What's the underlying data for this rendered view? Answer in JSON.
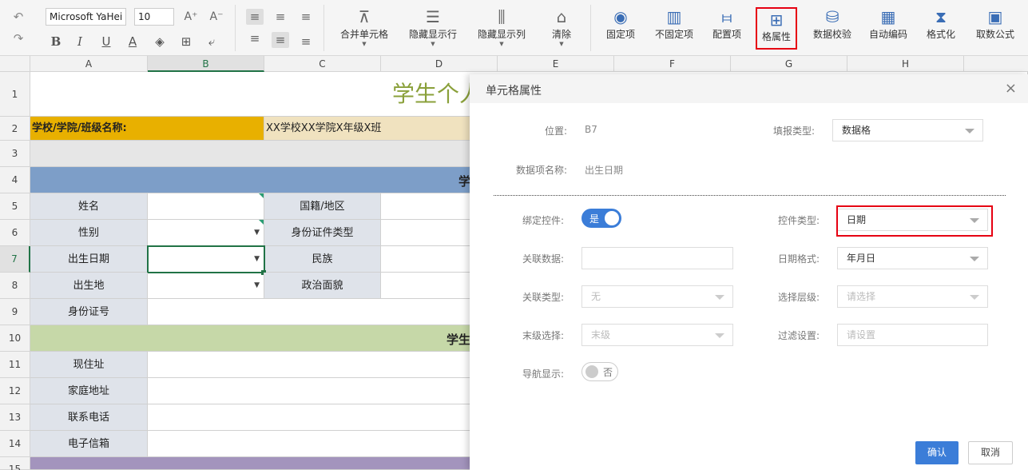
{
  "toolbar": {
    "font_name": "Microsoft YaHei",
    "font_size": "10",
    "buttons": [
      {
        "label": "合并单元格",
        "icon": "merge-cells-icon"
      },
      {
        "label": "隐藏显示行",
        "icon": "hide-rows-icon"
      },
      {
        "label": "隐藏显示列",
        "icon": "hide-columns-icon"
      },
      {
        "label": "清除",
        "icon": "eraser-icon"
      },
      {
        "label": "固定项",
        "icon": "fixed-item-icon"
      },
      {
        "label": "不固定项",
        "icon": "unfixed-item-icon"
      },
      {
        "label": "配置项",
        "icon": "config-icon"
      },
      {
        "label": "格属性",
        "icon": "cell-property-icon"
      },
      {
        "label": "数据校验",
        "icon": "data-validation-icon"
      },
      {
        "label": "自动编码",
        "icon": "barcode-icon"
      },
      {
        "label": "格式化",
        "icon": "hourglass-icon"
      },
      {
        "label": "取数公式",
        "icon": "book-icon"
      }
    ],
    "selected_button": "格属性",
    "accent_color": "#e60012"
  },
  "sheet": {
    "columns": [
      "A",
      "B",
      "C",
      "D",
      "E",
      "F",
      "G",
      "H"
    ],
    "selected_column": "B",
    "rows": [
      "1",
      "2",
      "3",
      "4",
      "5",
      "6",
      "7",
      "8",
      "9",
      "10",
      "11",
      "12",
      "13",
      "14",
      "15"
    ],
    "selected_row": "7",
    "title": "学生个人",
    "school_label": "学校/学院/班级名称:",
    "school_value": "XX学校XX学院X年级X班",
    "section1": "学",
    "section2": "学生",
    "labels": {
      "name": "姓名",
      "gender": "性别",
      "birthdate": "出生日期",
      "birthplace": "出生地",
      "id_number": "身份证号",
      "nationality": "国籍/地区",
      "id_type": "身份证件类型",
      "ethnicity": "民族",
      "political": "政治面貌",
      "address": "现住址",
      "home_address": "家庭地址",
      "phone": "联系电话",
      "email": "电子信箱"
    },
    "colors": {
      "title": "#8aa03a",
      "school_label_bg": "#e8b000",
      "school_value_bg": "#f0e2bf",
      "section1_bg": "#7d9ec8",
      "section2_bg": "#c6d8a8",
      "label_bg": "#dfe3ea",
      "row15_bg": "#a394bd"
    }
  },
  "dialog": {
    "title": "单元格属性",
    "position_label": "位置:",
    "position_value": "B7",
    "fill_type_label": "填报类型:",
    "fill_type_value": "数据格",
    "item_name_label": "数据项名称:",
    "item_name_value": "出生日期",
    "bind_control_label": "绑定控件:",
    "bind_control_on": "是",
    "control_type_label": "控件类型:",
    "control_type_value": "日期",
    "linked_data_label": "关联数据:",
    "linked_data_value": "",
    "date_format_label": "日期格式:",
    "date_format_value": "年月日",
    "link_type_label": "关联类型:",
    "link_type_value": "无",
    "select_level_label": "选择层级:",
    "select_level_placeholder": "请选择",
    "last_level_label": "末级选择:",
    "last_level_value": "末级",
    "filter_label": "过滤设置:",
    "filter_placeholder": "请设置",
    "nav_display_label": "导航显示:",
    "nav_display_off": "否",
    "confirm_label": "确认",
    "cancel_label": "取消",
    "primary_color": "#3b7dd8"
  }
}
